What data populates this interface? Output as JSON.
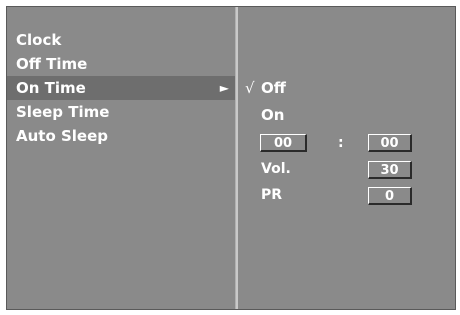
{
  "menu": {
    "items": [
      {
        "label": "Clock"
      },
      {
        "label": "Off Time"
      },
      {
        "label": "On Time"
      },
      {
        "label": "Sleep Time"
      },
      {
        "label": "Auto Sleep"
      }
    ],
    "selected_arrow": "►"
  },
  "submenu": {
    "check_mark": "√",
    "options": [
      {
        "label": "Off",
        "checked": true
      },
      {
        "label": "On",
        "checked": false
      }
    ],
    "time": {
      "hours": "00",
      "separator": ":",
      "minutes": "00"
    },
    "volume": {
      "label": "Vol.",
      "value": "30"
    },
    "program": {
      "label": "PR",
      "value": "0"
    }
  },
  "colors": {
    "background": "#8a8a8a",
    "highlight": "#6e6e6e",
    "text": "#ffffff"
  }
}
